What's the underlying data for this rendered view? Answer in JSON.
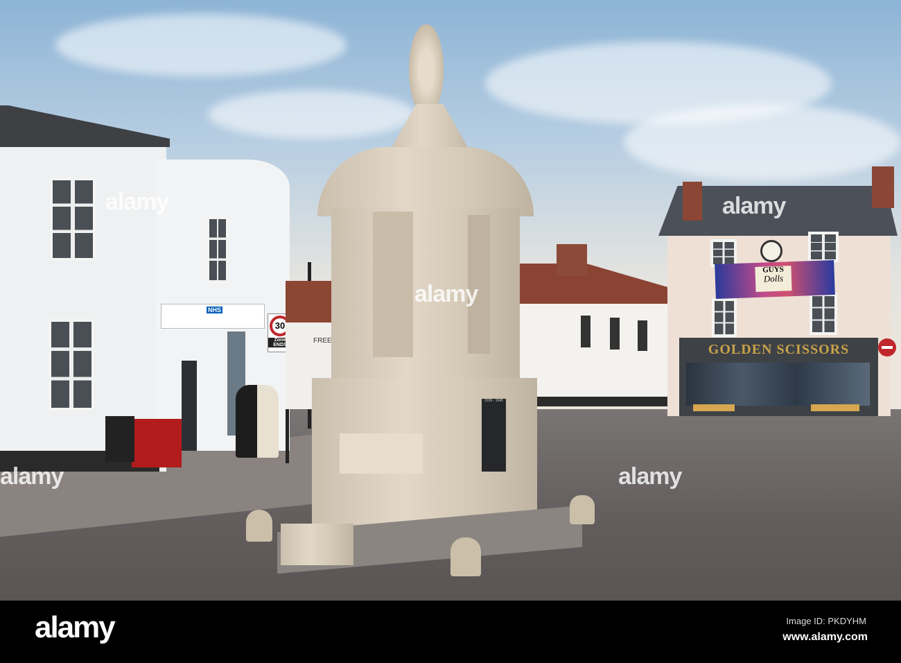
{
  "photo": {
    "shop_sign": "GOLDEN SCISSORS",
    "banner_title": "GUYS",
    "banner_subtitle": "Dolls",
    "speed_sign": "30",
    "zone_sign": "Zone ENDS",
    "nhs_label": "NHS",
    "pub_sign": "FREE H",
    "memorial_dates": "1939 - 1945"
  },
  "watermarks": [
    "alamy",
    "alamy",
    "alamy",
    "alamy",
    "a",
    "a"
  ],
  "footer": {
    "logo": "alamy",
    "image_id": "Image ID: PKDYHM",
    "website": "www.alamy.com"
  },
  "colors": {
    "footer_bg": "#000000",
    "sign_gold": "#c9a24a",
    "shopfront": "#474a4c"
  }
}
